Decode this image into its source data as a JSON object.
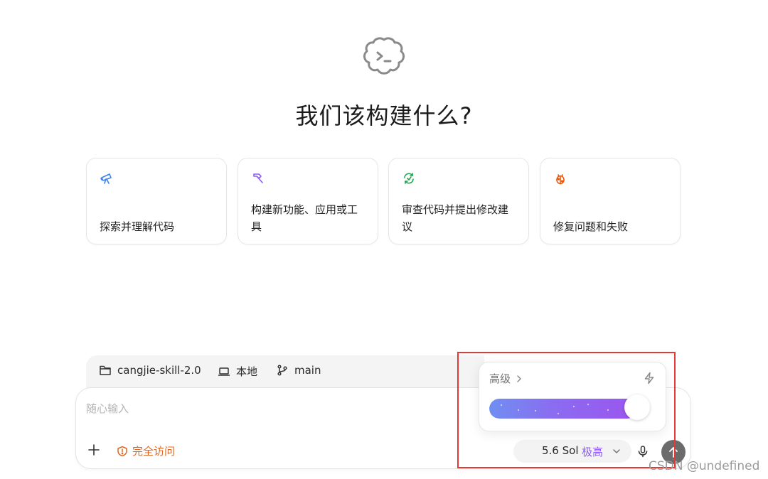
{
  "headline": "我们该构建什么?",
  "cards": [
    {
      "label": "探索并理解代码",
      "icon": "telescope-icon",
      "color": "#3b82f6"
    },
    {
      "label": "构建新功能、应用或工具",
      "icon": "hammer-icon",
      "color": "#8b5cf6"
    },
    {
      "label": "审查代码并提出修改建议",
      "icon": "review-refresh-icon",
      "color": "#16a34a"
    },
    {
      "label": "修复问题和失败",
      "icon": "bug-icon",
      "color": "#ea580c"
    }
  ],
  "context": {
    "folder": "cangjie-skill-2.0",
    "environment": "本地",
    "branch": "main"
  },
  "composer": {
    "placeholder": "随心输入",
    "access_label": "完全访问",
    "model": "5.6 Sol",
    "level": "极高"
  },
  "popover": {
    "title": "高级",
    "slider_fraction": 0.95
  },
  "watermark": "CSDN @undefined"
}
